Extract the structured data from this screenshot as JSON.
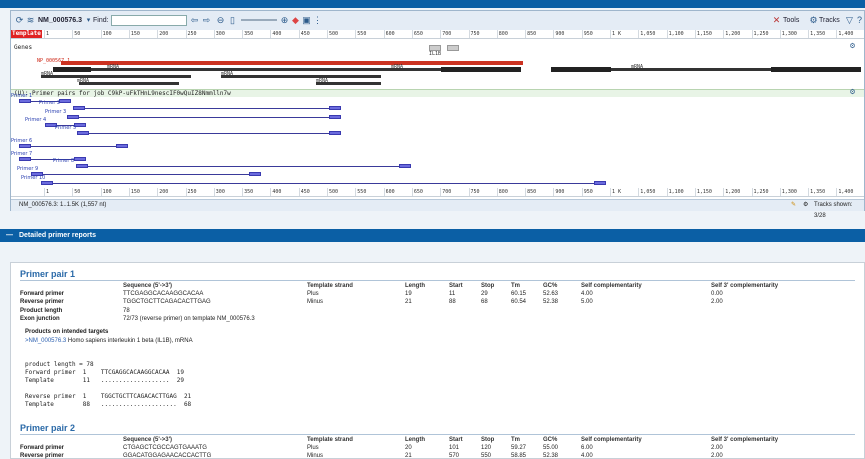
{
  "toolbar": {
    "accession": "NM_000576.3",
    "find_label": "Find:",
    "find_value": "",
    "tools_label": "Tools",
    "tracks_label": "Tracks"
  },
  "ruler_ticks": [
    "1",
    "50",
    "100",
    "150",
    "200",
    "250",
    "300",
    "350",
    "400",
    "450",
    "500",
    "550",
    "600",
    "650",
    "700",
    "750",
    "800",
    "850",
    "900",
    "950",
    "1 K",
    "1,050",
    "1,100",
    "1,150",
    "1,200",
    "1,250",
    "1,300",
    "1,350",
    "1,400",
    "1,450",
    "1,5"
  ],
  "viewer": {
    "template_label": "Template",
    "genes_label": "Genes",
    "gene_name": "IL1B",
    "protein_label": "NP_000567.1",
    "mrna_labels": [
      "mRNA",
      "mRNA",
      "mRNA",
      "mRNA",
      "mRNA",
      "mRNA",
      "mRNA"
    ],
    "primer_track_title": "(U): Primer pairs for job C9kP-uFkTHnL9nescIF0wQuIZ8Nmmlln7w",
    "primer_labels": [
      "Primer 1",
      "Primer 2",
      "Primer 3",
      "Primer 4",
      "Primer 5",
      "Primer 6",
      "Primer 7",
      "Primer 8",
      "Primer 9",
      "Primer 10"
    ],
    "status_left": "NM_000576.3: 1..1.5K (1,557 nt)",
    "status_right": "Tracks shown: 3/28"
  },
  "section_title": "Detailed primer reports",
  "columns": [
    "Sequence (5'->3')",
    "Template strand",
    "Length",
    "Start",
    "Stop",
    "Tm",
    "GC%",
    "Self complementarity",
    "Self 3' complementarity"
  ],
  "pair1": {
    "title": "Primer pair 1",
    "forward": {
      "label": "Forward primer",
      "seq": "TTCGAGGCACAAGGCACAA",
      "strand": "Plus",
      "length": "19",
      "start": "11",
      "stop": "29",
      "tm": "60.15",
      "gc": "52.63",
      "self": "4.00",
      "self3": "0.00"
    },
    "reverse": {
      "label": "Reverse primer",
      "seq": "TGGCTGCTTCAGACACTTGAG",
      "strand": "Minus",
      "length": "21",
      "start": "88",
      "stop": "68",
      "tm": "60.54",
      "gc": "52.38",
      "self": "5.00",
      "self3": "2.00"
    },
    "product_length_label": "Product length",
    "product_length": "78",
    "exon_junction_label": "Exon junction",
    "exon_junction": "72/73 (reverse primer) on template NM_000576.3",
    "products_heading": "Products on intended targets",
    "product_link": ">NM_000576.3",
    "product_desc": " Homo sapiens interleukin 1 beta (IL1B), mRNA",
    "align_product": "product length = 78",
    "align_fwd1": "Forward primer  1    TTCGAGGCACAAGGCACAA  19",
    "align_fwd2": "Template        11   ...................  29",
    "align_rev1": "Reverse primer  1    TGGCTGCTTCAGACACTTGAG  21",
    "align_rev2": "Template        88   .....................  68"
  },
  "pair2": {
    "title": "Primer pair 2",
    "forward": {
      "label": "Forward primer",
      "seq": "CTGAGCTCGCCAGTGAAATG",
      "strand": "Plus",
      "length": "20",
      "start": "101",
      "stop": "120",
      "tm": "59.27",
      "gc": "55.00",
      "self": "6.00",
      "self3": "2.00"
    },
    "reverse": {
      "label": "Reverse primer",
      "seq": "GGACATGGAGAACACCACTTG",
      "strand": "Minus",
      "length": "21",
      "start": "570",
      "stop": "550",
      "tm": "58.85",
      "gc": "52.38",
      "self": "4.00",
      "self3": "2.00"
    }
  }
}
